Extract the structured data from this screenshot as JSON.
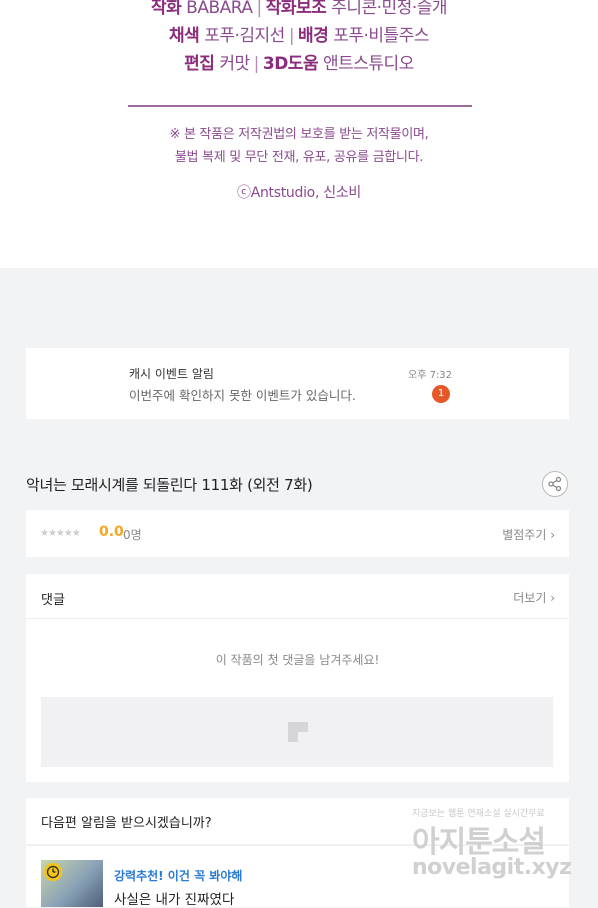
{
  "credits": {
    "line1": {
      "label_a": "작화",
      "value_a": "BABARA",
      "label_b": "작화보조",
      "value_b": "주니콘·민정·슬개"
    },
    "line2": {
      "label_a": "채색",
      "value_a": "포푸·김지선",
      "label_b": "배경",
      "value_b": "포푸·비틀주스"
    },
    "line3": {
      "label_a": "편집",
      "value_a": "커맛",
      "label_b": "3D도움",
      "value_b": "앤트스튜디오"
    },
    "separator": "|",
    "notice_line1": "※ 본 작품은 저작권법의 보호를 받는 저작물이며,",
    "notice_line2": "불법 복제 및 무단 전재, 유포, 공유를 금합니다.",
    "copyright": "ⓒAntstudio, 신소비"
  },
  "alert": {
    "title": "캐시 이벤트 알림",
    "body": "이번주에 확인하지 못한 이벤트가 있습니다.",
    "time": "오후 7:32",
    "badge": "1"
  },
  "episode": {
    "title": "악녀는 모래시계를 되돌린다 111화 (외전 7화)",
    "share_icon": "share-icon"
  },
  "rating": {
    "stars": "★★★★★",
    "score": "0.0",
    "count": "0명",
    "rate_button": "별점주기 ›",
    "star_color": "#cccccc",
    "score_color": "#f5a623"
  },
  "comments": {
    "heading": "댓글",
    "more_button": "더보기 ›",
    "empty_message": "이 작품의 첫 댓글을 남겨주세요!"
  },
  "notify": {
    "question": "다음편 알림을 받으시겠습니까?"
  },
  "recommend": {
    "tag": "강력추천! 이건 꼭 봐야해",
    "title": "사실은 내가 진짜였다",
    "tag_color": "#2a7bd4"
  },
  "watermark": {
    "small": "지금보는 웹툰 연재소설 실시간무료",
    "big": "아지툰소설",
    "url": "novelagit.xyz"
  }
}
